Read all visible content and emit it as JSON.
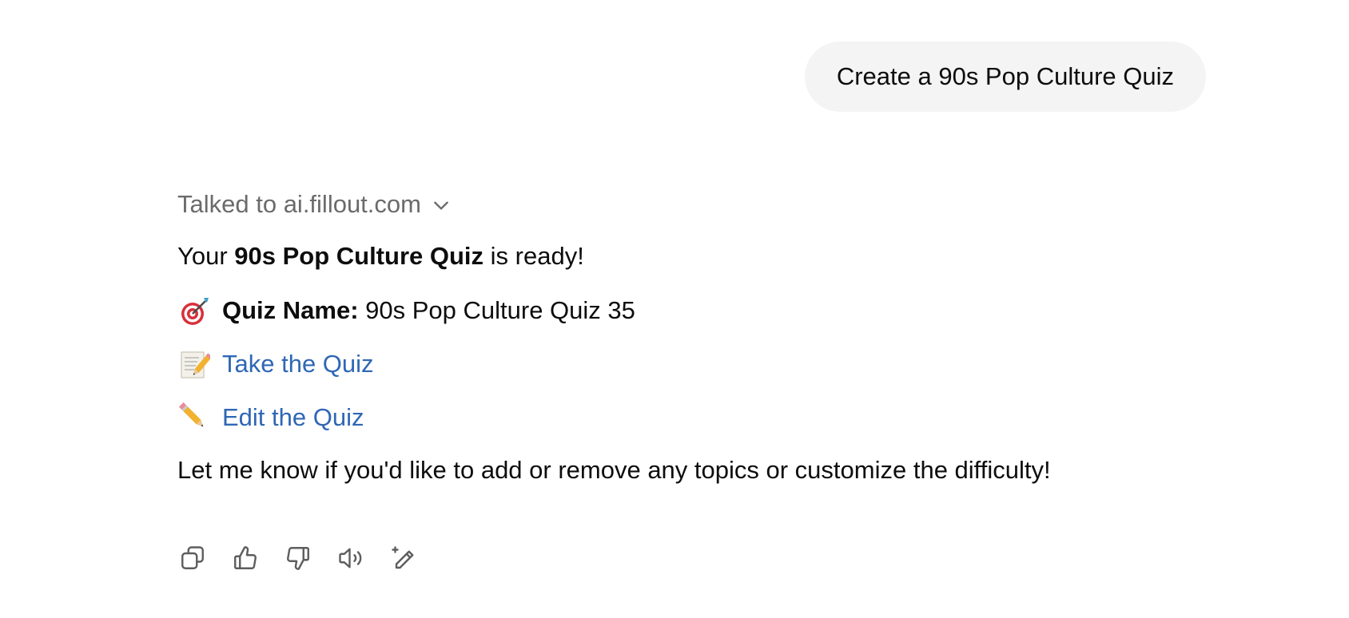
{
  "user_message": {
    "text": "Create a 90s Pop Culture Quiz"
  },
  "assistant": {
    "tool_call": {
      "label": "Talked to ai.fillout.com",
      "icon": "chevron-down-icon"
    },
    "intro": {
      "before": "Your ",
      "bold": "90s Pop Culture Quiz",
      "after": " is ready!"
    },
    "quiz_name": {
      "icon": "dart-target-icon",
      "label": "Quiz Name:",
      "value": " 90s Pop Culture Quiz 35"
    },
    "take_link": {
      "icon": "memo-pencil-icon",
      "text": "Take the Quiz"
    },
    "edit_link": {
      "icon": "pencil-icon",
      "text": "Edit the Quiz"
    },
    "closing": "Let me know if you'd like to add or remove any topics or customize the difficulty!",
    "actions": [
      "copy-icon",
      "thumbs-up-icon",
      "thumbs-down-icon",
      "read-aloud-icon",
      "edit-sparkle-icon"
    ]
  },
  "colors": {
    "link": "#2f67b5",
    "muted": "#6b6b6b",
    "bubble": "#f4f4f4",
    "text": "#0d0d0d"
  }
}
